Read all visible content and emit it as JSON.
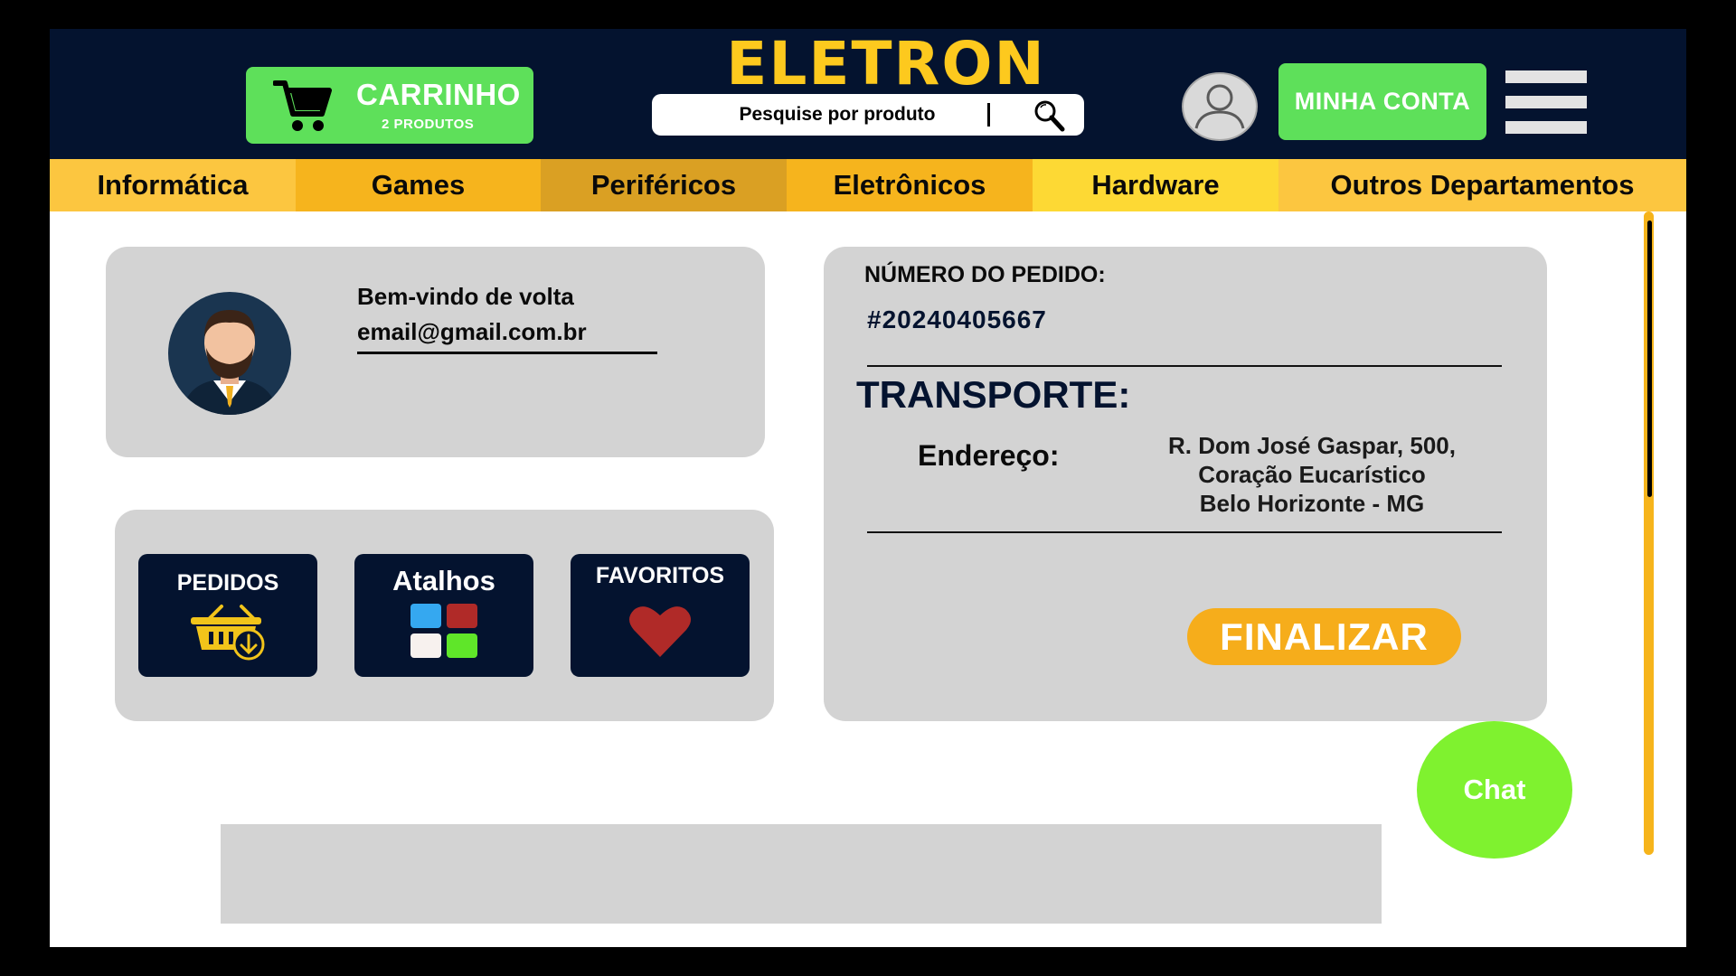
{
  "header": {
    "cart": {
      "title": "CARRINHO",
      "subtitle": "2 PRODUTOS",
      "icon": "cart-icon"
    },
    "logo": "ELETRON",
    "search": {
      "placeholder": "Pesquise por produto",
      "icon": "search-icon"
    },
    "avatar_icon": "user-avatar-icon",
    "account_label": "MINHA CONTA",
    "menu_icon": "hamburger-menu-icon"
  },
  "nav": {
    "items": [
      {
        "label": "Informática",
        "color": "#fcc640"
      },
      {
        "label": "Games",
        "color": "#f6b41d"
      },
      {
        "label": "Periféricos",
        "color": "#daa023"
      },
      {
        "label": "Eletrônicos",
        "color": "#f6b41d"
      },
      {
        "label": "Hardware",
        "color": "#fdd934"
      },
      {
        "label": "Outros Departamentos",
        "color": "#fcc640"
      }
    ]
  },
  "profile": {
    "welcome": "Bem-vindo de volta",
    "email": "email@gmail.com.br",
    "avatar_icon": "profile-avatar-icon"
  },
  "shortcuts": {
    "orders": {
      "label": "PEDIDOS",
      "icon": "basket-download-icon"
    },
    "shortcuts": {
      "label": "Atalhos",
      "icon": "grid-apps-icon"
    },
    "favorites": {
      "label": "FAVORITOS",
      "icon": "heart-icon"
    }
  },
  "order": {
    "number_label": "NÚMERO DO PEDIDO:",
    "number": "#20240405667",
    "transport_title": "TRANSPORTE:",
    "address_label": "Endereço:",
    "address_lines": [
      "R. Dom José Gaspar, 500,",
      "Coração Eucarístico",
      "Belo Horizonte - MG"
    ],
    "finalize_label": "FINALIZAR"
  },
  "chat_label": "Chat",
  "colors": {
    "header_bg": "#04132f",
    "brand_yellow": "#fdc91e",
    "green": "#5ee05a",
    "chat_green": "#7ff22f",
    "card_gray": "#d3d3d3",
    "finalize_orange": "#f6ad1b"
  }
}
